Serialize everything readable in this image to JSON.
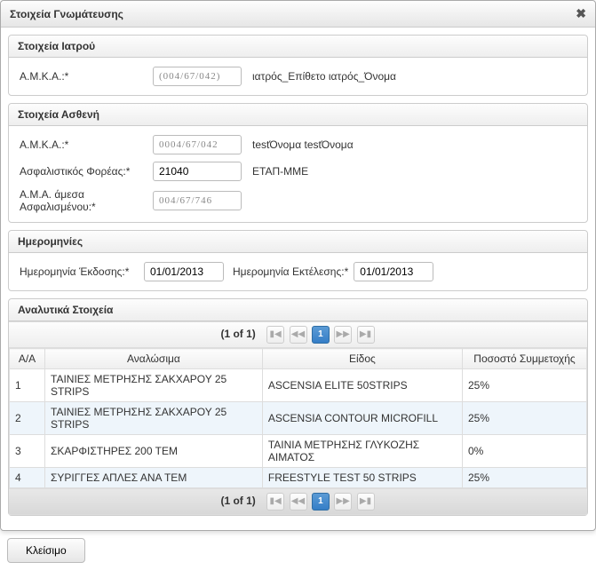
{
  "dialog": {
    "title": "Στοιχεία Γνωμάτευσης"
  },
  "doctor": {
    "panel_title": "Στοιχεία Ιατρού",
    "amka_label": "Α.Μ.Κ.Α.:*",
    "amka_value": "(004/67/042)",
    "name": "ιατρός_Επίθετο ιατρός_Όνομα"
  },
  "patient": {
    "panel_title": "Στοιχεία Ασθενή",
    "amka_label": "Α.Μ.Κ.Α.:*",
    "amka_value": "0004/67/042",
    "name": "testΌνομα testΌνομα",
    "ins_org_label": "Ασφαλιστικός Φορέας:*",
    "ins_org_value": "21040",
    "ins_org_name": "ΕΤΑΠ-ΜΜΕ",
    "direct_amka_label": "Α.Μ.Α. άμεσα Ασφαλισμένου:*",
    "direct_amka_value": "004/67/746"
  },
  "dates": {
    "panel_title": "Ημερομηνίες",
    "issue_label": "Ημερομηνία Έκδοσης:*",
    "issue_value": "01/01/2013",
    "exec_label": "Ημερομηνία Εκτέλεσης:*",
    "exec_value": "01/01/2013"
  },
  "details": {
    "panel_title": "Αναλυτικά Στοιχεία",
    "pagination": {
      "info": "(1 of 1)",
      "current": "1"
    },
    "columns": {
      "aa": "A/A",
      "consumable": "Αναλώσιμα",
      "type": "Είδος",
      "pct": "Ποσοστό Συμμετοχής"
    },
    "rows": [
      {
        "aa": "1",
        "consumable": "ΤΑΙΝΙΕΣ ΜΕΤΡΗΣΗΣ ΣΑΚΧΑΡΟΥ 25 STRIPS",
        "type": "ASCENSIA ELITE 50STRIPS",
        "pct": "25%"
      },
      {
        "aa": "2",
        "consumable": "ΤΑΙΝΙΕΣ ΜΕΤΡΗΣΗΣ ΣΑΚΧΑΡΟΥ 25 STRIPS",
        "type": "ASCENSIA CONTOUR MICROFILL",
        "pct": "25%"
      },
      {
        "aa": "3",
        "consumable": "ΣΚΑΡΦΙΣΤΗΡΕΣ 200 ΤΕΜ",
        "type": "ΤΑΙΝΙΑ ΜΕΤΡΗΣΗΣ ΓΛΥΚΟΖΗΣ ΑΙΜΑΤΟΣ",
        "pct": "0%"
      },
      {
        "aa": "4",
        "consumable": "ΣΥΡΙΓΓΕΣ ΑΠΛΕΣ ΑΝΑ ΤΕΜ",
        "type": "FREESTYLE TEST 50 STRIPS",
        "pct": "25%"
      }
    ]
  },
  "buttons": {
    "close": "Κλείσιμο"
  }
}
